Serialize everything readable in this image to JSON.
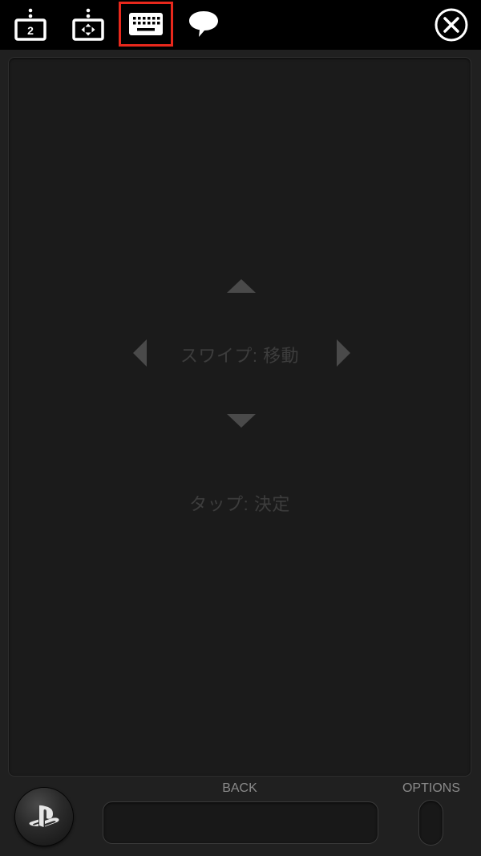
{
  "toolbar": {
    "buttons": [
      {
        "icon": "second-screen-icon",
        "label": "2",
        "selected": false
      },
      {
        "icon": "remote-dpad-icon",
        "selected": false
      },
      {
        "icon": "keyboard-icon",
        "selected": true
      },
      {
        "icon": "comment-icon",
        "selected": false
      }
    ],
    "close_icon": "close-icon",
    "highlight_color": "#e8281c"
  },
  "touchpad": {
    "swipe_hint": "スワイプ: 移動",
    "tap_hint": "タップ: 決定"
  },
  "controls": {
    "back_label": "BACK",
    "options_label": "OPTIONS",
    "ps_icon": "playstation-logo-icon"
  }
}
